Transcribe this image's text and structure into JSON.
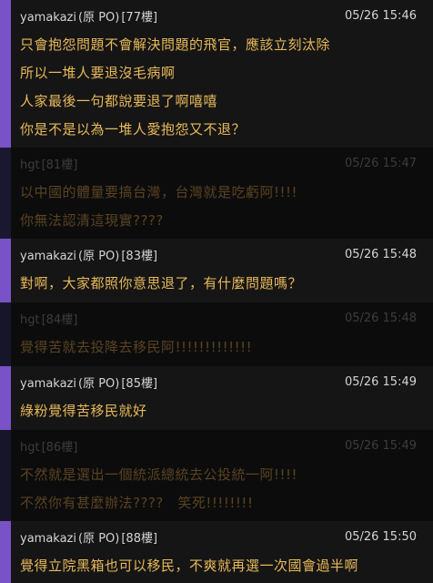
{
  "thread": {
    "comments": [
      {
        "kind": "op",
        "user": "yamakazi",
        "tag": "(原 PO)",
        "floor": "[77樓]",
        "time": "05/26 15:46",
        "lines": [
          "只會抱怨問題不會解決問題的飛官，應該立刻汰除",
          "所以一堆人要退沒毛病啊",
          "人家最後一句都說要退了啊嘻嘻",
          "你是不是以為一堆人愛抱怨又不退？"
        ]
      },
      {
        "kind": "other",
        "user": "hgt",
        "tag": "",
        "floor": "[81樓]",
        "time": "05/26 15:47",
        "lines": [
          "以中國的體量要搞台灣，台灣就是吃虧阿!!!!",
          "你無法認清這現實????"
        ]
      },
      {
        "kind": "op",
        "user": "yamakazi",
        "tag": "(原 PO)",
        "floor": "[83樓]",
        "time": "05/26 15:48",
        "lines": [
          "對啊，大家都照你意思退了，有什麼問題嗎？"
        ]
      },
      {
        "kind": "other",
        "user": "hgt",
        "tag": "",
        "floor": "[84樓]",
        "time": "05/26 15:48",
        "lines": [
          "覺得苦就去投降去移民阿!!!!!!!!!!!!!"
        ]
      },
      {
        "kind": "op",
        "user": "yamakazi",
        "tag": "(原 PO)",
        "floor": "[85樓]",
        "time": "05/26 15:49",
        "lines": [
          "綠粉覺得苦移民就好"
        ]
      },
      {
        "kind": "other",
        "user": "hgt",
        "tag": "",
        "floor": "[86樓]",
        "time": "05/26 15:49",
        "lines": [
          "不然就是選出一個統派總統去公投統一阿!!!!",
          "不然你有甚麼辦法????　笑死!!!!!!!!"
        ]
      },
      {
        "kind": "op",
        "user": "yamakazi",
        "tag": "(原 PO)",
        "floor": "[88樓]",
        "time": "05/26 15:50",
        "lines": [
          "覺得立院黑箱也可以移民，不爽就再選一次國會過半啊"
        ]
      }
    ]
  }
}
